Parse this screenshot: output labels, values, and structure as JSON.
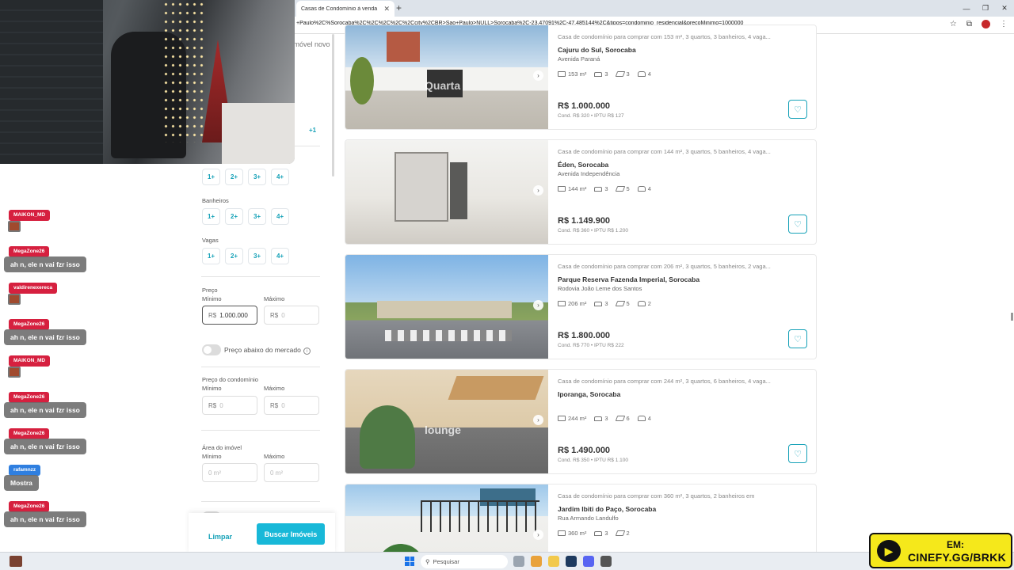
{
  "browser": {
    "tab_title": "Casas de Condomínio à venda",
    "url": "+Paulo%2C%Sorocaba%2C%2C%2C%2C%2Ccity%2CBR>Sao+Paulo>NULL>Sorocaba%2C-23.47091%2C-47.485144%2C&tipos=condominio_residencial&precoMinimo=1000000"
  },
  "filters": {
    "imovel_novo": "Imóvel novo",
    "more_count": "+1",
    "quartos_options": [
      "1+",
      "2+",
      "3+",
      "4+"
    ],
    "banheiros_label": "Banheiros",
    "banheiros_options": [
      "1+",
      "2+",
      "3+",
      "4+"
    ],
    "vagas_label": "Vagas",
    "vagas_options": [
      "1+",
      "2+",
      "3+",
      "4+"
    ],
    "preco_label": "Preço",
    "minimo_label": "Mínimo",
    "maximo_label": "Máximo",
    "currency": "R$",
    "preco_min_value": "1.000.000",
    "preco_max_placeholder": "0",
    "abaixo_mercado_label": "Preço abaixo do mercado",
    "condominio_label": "Preço do condomínio",
    "cond_min_placeholder": "0",
    "cond_max_placeholder": "0",
    "area_label": "Área do imóvel",
    "area_min_placeholder": "0 m²",
    "area_max_placeholder": "0 m²",
    "limpar_label": "Limpar",
    "buscar_label": "Buscar Imóveis"
  },
  "listings": [
    {
      "desc": "Casa de condomínio para comprar com 153 m², 3 quartos, 3 banheiros, 4 vaga...",
      "title": "Cajuru do Sul, Sorocaba",
      "address": "Avenida Paraná",
      "area": "153 m²",
      "quartos": "3",
      "banheiros": "3",
      "vagas": "4",
      "price": "R$ 1.000.000",
      "fees": "Cond. R$ 320 • IPTU R$ 127",
      "watermark": "Quarta"
    },
    {
      "desc": "Casa de condomínio para comprar com 144 m², 3 quartos, 5 banheiros, 4 vaga...",
      "title": "Éden, Sorocaba",
      "address": "Avenida Independência",
      "area": "144 m²",
      "quartos": "3",
      "banheiros": "5",
      "vagas": "4",
      "price": "R$ 1.149.900",
      "fees": "Cond. R$ 360 • IPTU R$ 1.200",
      "watermark": ""
    },
    {
      "desc": "Casa de condomínio para comprar com 206 m², 3 quartos, 5 banheiros, 2 vaga...",
      "title": "Parque Reserva Fazenda Imperial, Sorocaba",
      "address": "Rodovia João Leme dos Santos",
      "area": "206 m²",
      "quartos": "3",
      "banheiros": "5",
      "vagas": "2",
      "price": "R$ 1.800.000",
      "fees": "Cond. R$ 770 • IPTU R$ 222",
      "watermark": ""
    },
    {
      "desc": "Casa de condomínio para comprar com 244 m², 3 quartos, 6 banheiros, 4 vaga...",
      "title": "Iporanga, Sorocaba",
      "address": "",
      "area": "244 m²",
      "quartos": "3",
      "banheiros": "6",
      "vagas": "4",
      "price": "R$ 1.490.000",
      "fees": "Cond. R$ 350 • IPTU R$ 1.100",
      "watermark": "lounge"
    },
    {
      "desc": "Casa de condomínio para comprar com 360 m², 3 quartos, 2 banheiros em",
      "title": "Jardim Ibiti do Paço, Sorocaba",
      "address": "Rua Armando Landulfo",
      "area": "360 m²",
      "quartos": "3",
      "banheiros": "2",
      "vagas": "",
      "price": "",
      "fees": "",
      "watermark": ""
    }
  ],
  "chat": [
    {
      "user": "MAIKON_MD",
      "msg": "",
      "color": "#d6203f"
    },
    {
      "user": "MegaZone26",
      "msg": "ah n, ele n vai fzr isso",
      "color": "#d6203f"
    },
    {
      "user": "valdirenexereca",
      "msg": "",
      "color": "#d6203f"
    },
    {
      "user": "MegaZone26",
      "msg": "ah n, ele n vai fzr isso",
      "color": "#d6203f"
    },
    {
      "user": "MAIKON_MD",
      "msg": "",
      "color": "#d6203f"
    },
    {
      "user": "MegaZone26",
      "msg": "ah n, ele n vai fzr isso",
      "color": "#d6203f"
    },
    {
      "user": "MegaZone26",
      "msg": "ah n, ele n vai fzr isso",
      "color": "#d6203f"
    },
    {
      "user": "rafamnzz",
      "msg": "Mostra",
      "color": "#2f7fe0"
    },
    {
      "user": "MegaZone26",
      "msg": "ah n, ele n vai fzr isso",
      "color": "#d6203f"
    }
  ],
  "taskbar": {
    "search_label": "Pesquisar"
  },
  "badge": {
    "line1": "EM:",
    "line2": "CINEFY.GG/BRKK"
  },
  "colors": {
    "accent": "#18b8d8",
    "chat_red": "#d6203f",
    "badge_yellow": "#f5e81b"
  }
}
